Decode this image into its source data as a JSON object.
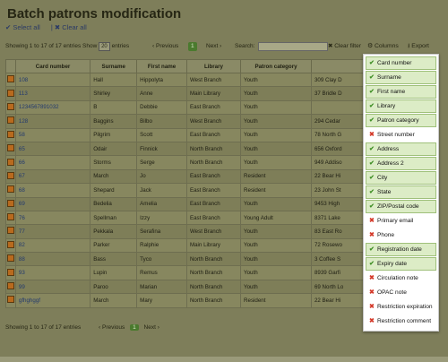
{
  "page_title": "Batch patrons modification",
  "selection": {
    "select_all": "Select all",
    "clear_all": "Clear all"
  },
  "controls": {
    "info": "Showing 1 to 17 of 17 entries",
    "show_label": "Show",
    "show_value": "20",
    "entries_label": "entries",
    "previous": "Previous",
    "page": "1",
    "next": "Next",
    "search_label": "Search:",
    "clear_filter": "Clear filter",
    "columns": "Columns",
    "export": "Export"
  },
  "table": {
    "headers": [
      "",
      "Card number",
      "Surname",
      "First name",
      "Library",
      "Patron category",
      ""
    ],
    "rows": [
      [
        "108",
        "Hall",
        "Hippolyta",
        "West Branch",
        "Youth",
        "309 Clay D"
      ],
      [
        "113",
        "Shirley",
        "Anne",
        "Main Library",
        "Youth",
        "37 Bridle D"
      ],
      [
        "1234567891032",
        "B",
        "Debbie",
        "East Branch",
        "Youth",
        ""
      ],
      [
        "128",
        "Baggins",
        "Bilbo",
        "West Branch",
        "Youth",
        "294 Cedar"
      ],
      [
        "58",
        "Pilgrim",
        "Scott",
        "East Branch",
        "Youth",
        "78 North G"
      ],
      [
        "65",
        "Odair",
        "Finnick",
        "North Branch",
        "Youth",
        "656 Oxford"
      ],
      [
        "66",
        "Storms",
        "Serge",
        "North Branch",
        "Youth",
        "949 Addiso"
      ],
      [
        "67",
        "March",
        "Jo",
        "East Branch",
        "Resident",
        "22 Bear Hi"
      ],
      [
        "68",
        "Shepard",
        "Jack",
        "East Branch",
        "Resident",
        "23 John St"
      ],
      [
        "69",
        "Bedelia",
        "Amelia",
        "East Branch",
        "Youth",
        "9453 High"
      ],
      [
        "76",
        "Spellman",
        "Izzy",
        "East Branch",
        "Young Adult",
        "8371 Lake"
      ],
      [
        "77",
        "Pekkala",
        "Serafina",
        "West Branch",
        "Youth",
        "83 East Ro"
      ],
      [
        "82",
        "Parker",
        "Ralphie",
        "Main Library",
        "Youth",
        "72 Rosewo"
      ],
      [
        "88",
        "Bass",
        "Tyco",
        "North Branch",
        "Youth",
        "3 Coffee S"
      ],
      [
        "93",
        "Lupin",
        "Remus",
        "North Branch",
        "Youth",
        "8939 Garfi"
      ],
      [
        "99",
        "Paroo",
        "Marian",
        "North Branch",
        "Youth",
        "69 North Lo"
      ],
      [
        "gfhghggf",
        "March",
        "Mary",
        "North Branch",
        "Resident",
        "22 Bear Hi"
      ]
    ]
  },
  "footer": {
    "info": "Showing 1 to 17 of 17 entries",
    "previous": "Previous",
    "page": "1",
    "next": "Next"
  },
  "column_menu": [
    {
      "label": "Card number",
      "checked": true
    },
    {
      "label": "Surname",
      "checked": true
    },
    {
      "label": "First name",
      "checked": true
    },
    {
      "label": "Library",
      "checked": true
    },
    {
      "label": "Patron category",
      "checked": true
    },
    {
      "label": "Street number",
      "checked": false
    },
    {
      "label": "Address",
      "checked": true
    },
    {
      "label": "Address 2",
      "checked": true
    },
    {
      "label": "City",
      "checked": true
    },
    {
      "label": "State",
      "checked": true
    },
    {
      "label": "ZIP/Postal code",
      "checked": true
    },
    {
      "label": "Primary email",
      "checked": false
    },
    {
      "label": "Phone",
      "checked": false
    },
    {
      "label": "Registration date",
      "checked": true
    },
    {
      "label": "Expiry date",
      "checked": true
    },
    {
      "label": "Circulation note",
      "checked": false
    },
    {
      "label": "OPAC note",
      "checked": false
    },
    {
      "label": "Restriction expiration",
      "checked": false
    },
    {
      "label": "Restriction comment",
      "checked": false
    }
  ],
  "colors": {
    "checked_bg": "#dcecc6",
    "check_mark": "#3f8f25",
    "cross_mark": "#d43a2a",
    "overlay": "#7e7e5a"
  }
}
